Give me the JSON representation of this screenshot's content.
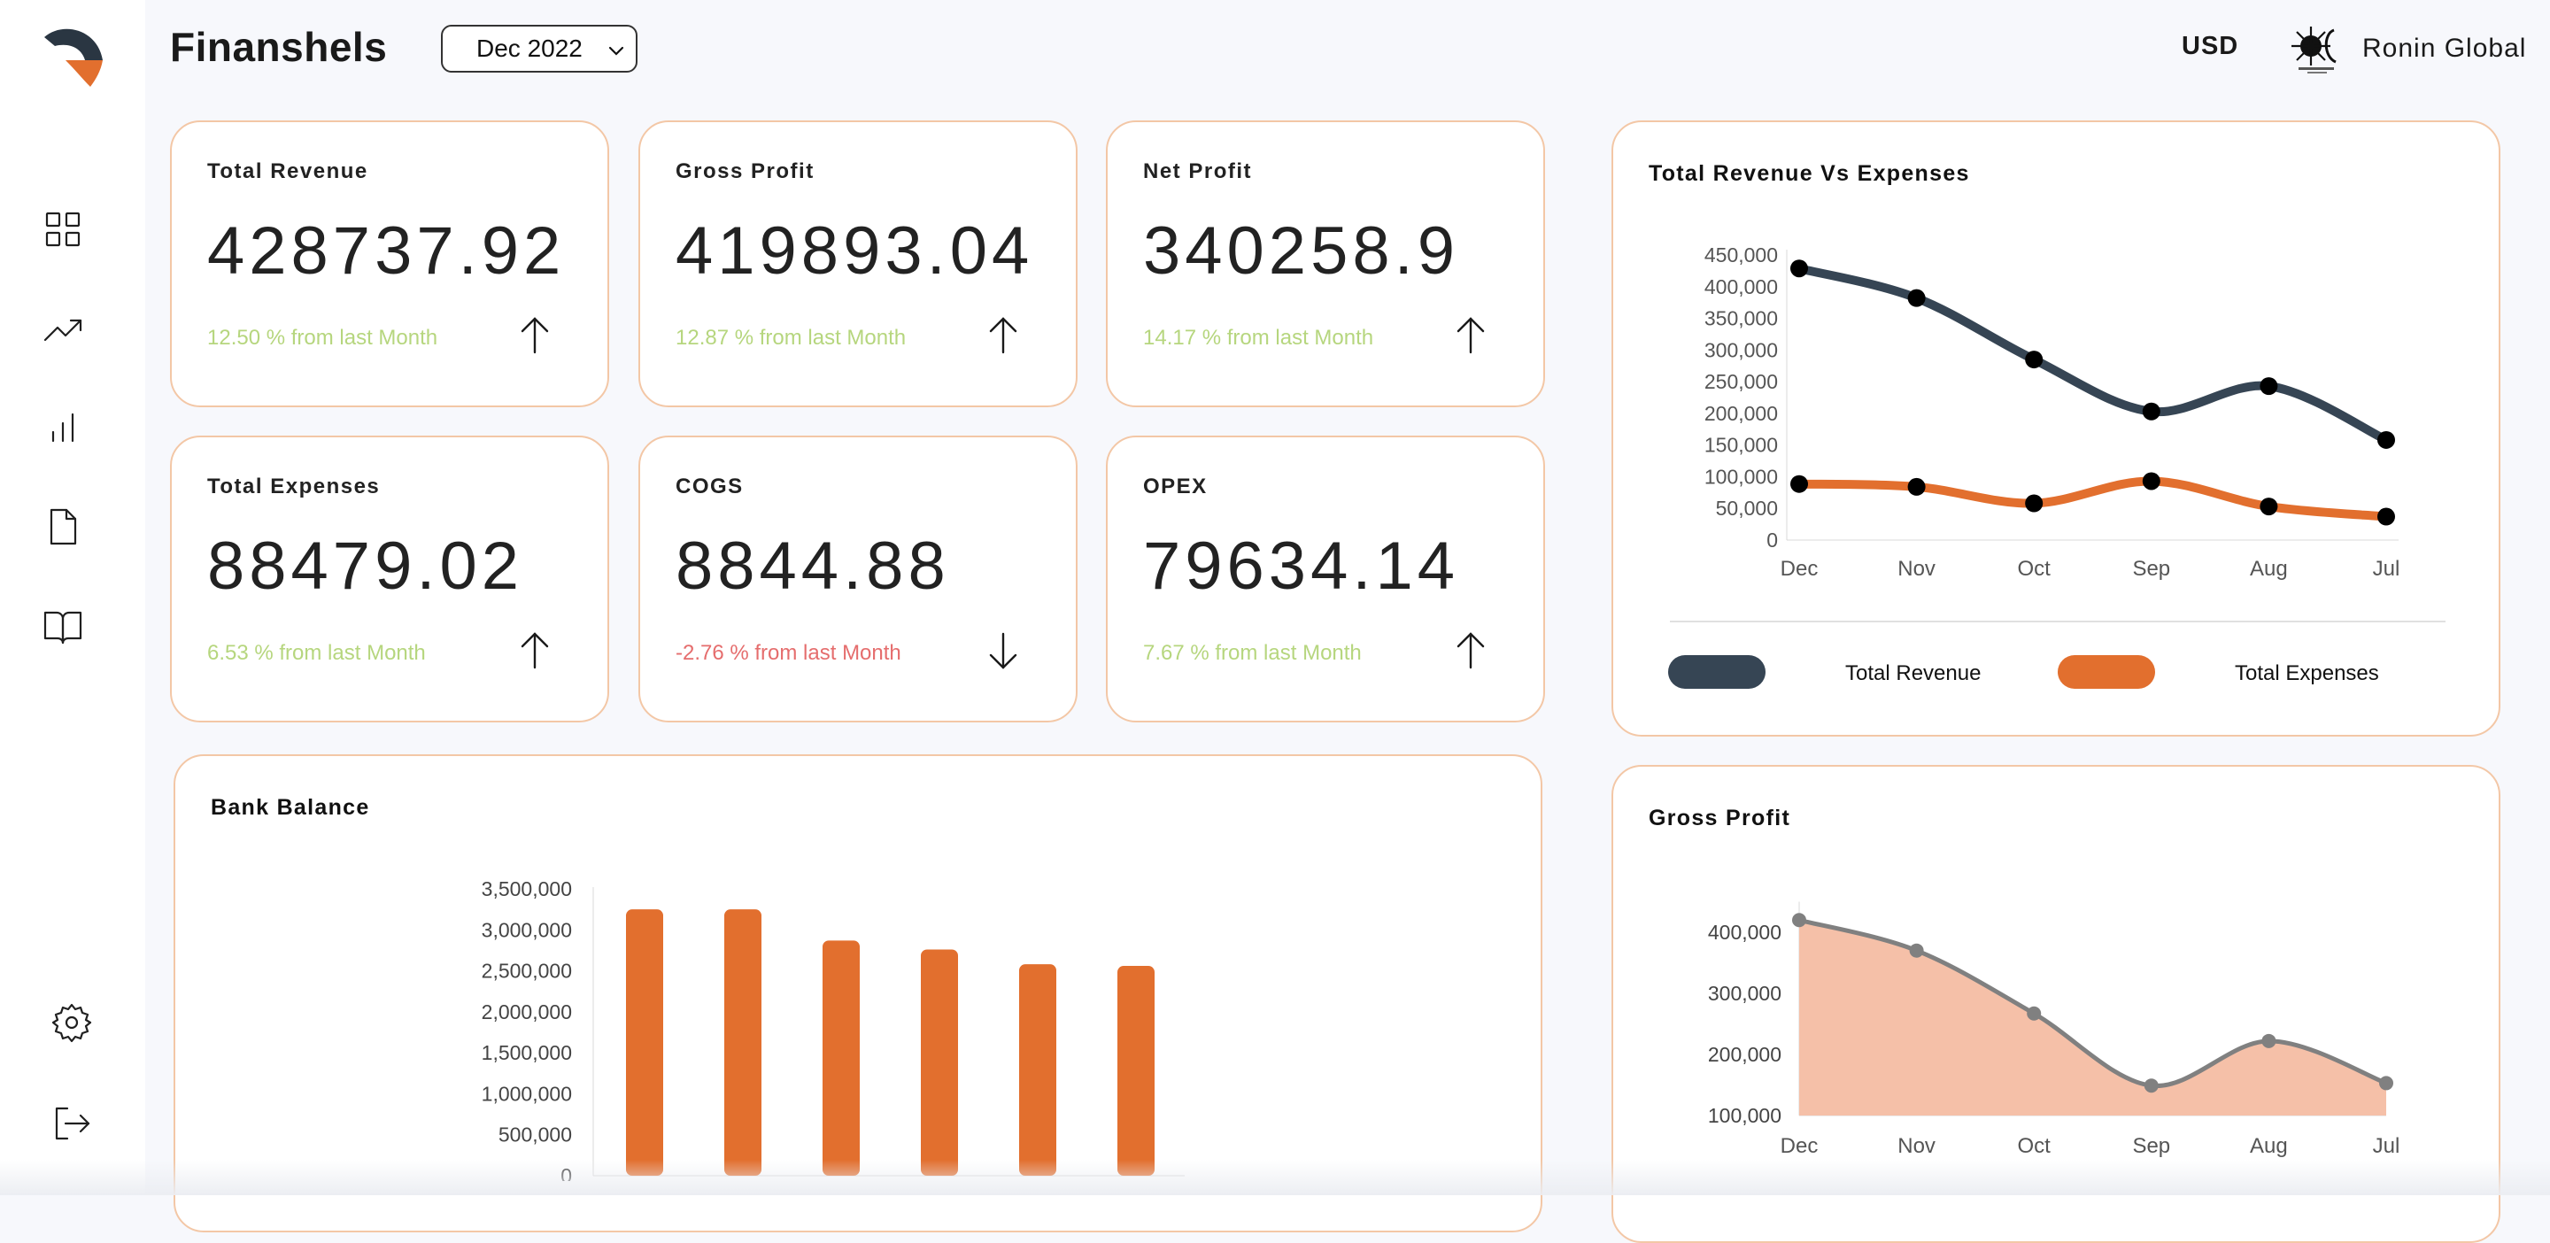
{
  "header": {
    "brand": "Finanshels",
    "date_select": "Dec 2022",
    "currency": "USD",
    "company": "Ronin Global"
  },
  "sidebar": {
    "items": [
      {
        "icon": "dashboard-grid-icon"
      },
      {
        "icon": "trend-up-icon"
      },
      {
        "icon": "bar-chart-icon"
      },
      {
        "icon": "document-icon"
      },
      {
        "icon": "book-icon"
      },
      {
        "icon": "gear-icon"
      },
      {
        "icon": "logout-icon"
      }
    ]
  },
  "kpis": [
    {
      "title": "Total Revenue",
      "value": "428737.92",
      "delta": "12.50 % from last Month",
      "direction": "up"
    },
    {
      "title": "Gross Profit",
      "value": "419893.04",
      "delta": "12.87 % from last Month",
      "direction": "up"
    },
    {
      "title": "Net Profit",
      "value": "340258.9",
      "delta": "14.17 % from last Month",
      "direction": "up"
    },
    {
      "title": "Total Expenses",
      "value": "88479.02",
      "delta": "6.53 % from last Month",
      "direction": "up"
    },
    {
      "title": "COGS",
      "value": "8844.88",
      "delta": "-2.76 % from last Month",
      "direction": "down"
    },
    {
      "title": "OPEX",
      "value": "79634.14",
      "delta": "7.67 % from last Month",
      "direction": "up"
    }
  ],
  "colors": {
    "revenue": "#364554",
    "expenses": "#e26f2e",
    "bar": "#e26f2e",
    "area_fill": "#f5c0a8",
    "area_line": "#808080",
    "delta_up": "#b6d67e",
    "delta_down": "#e56d6d",
    "card_border": "#f3c7a6"
  },
  "chart_data": [
    {
      "type": "line",
      "title": "Total Revenue Vs Expenses",
      "categories": [
        "Dec",
        "Nov",
        "Oct",
        "Sep",
        "Aug",
        "Jul"
      ],
      "series": [
        {
          "name": "Total Revenue",
          "values": [
            428738,
            382000,
            285000,
            203000,
            243000,
            158000
          ]
        },
        {
          "name": "Total Expenses",
          "values": [
            88479,
            84000,
            58000,
            93000,
            53000,
            37000
          ]
        }
      ],
      "yticks": [
        "450,000",
        "400,000",
        "350,000",
        "300,000",
        "250,000",
        "200,000",
        "150,000",
        "100,000",
        "50,000",
        "0"
      ],
      "ylim": [
        0,
        450000
      ],
      "legend": "bottom"
    },
    {
      "type": "bar",
      "title": "Bank Balance",
      "values": [
        3250000,
        3250000,
        2870000,
        2760000,
        2580000,
        2560000
      ],
      "yticks": [
        "3,500,000",
        "3,000,000",
        "2,500,000",
        "2,000,000",
        "1,500,000",
        "1,000,000",
        "500,000",
        "0"
      ],
      "ylim": [
        0,
        3500000
      ]
    },
    {
      "type": "area",
      "title": "Gross Profit",
      "categories": [
        "Dec",
        "Nov",
        "Oct",
        "Sep",
        "Aug",
        "Jul"
      ],
      "values": [
        419893,
        370000,
        267000,
        149000,
        222000,
        153000
      ],
      "yticks": [
        "400,000",
        "300,000",
        "200,000",
        "100,000"
      ],
      "ylim": [
        100000,
        450000
      ]
    }
  ]
}
